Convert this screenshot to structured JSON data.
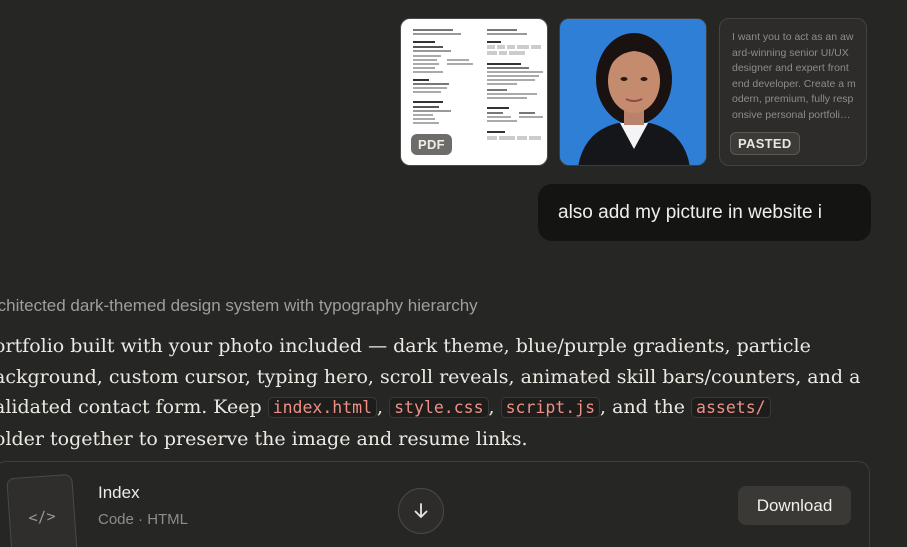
{
  "attachments": {
    "pdf_badge": "PDF",
    "paste_badge": "PASTED",
    "paste_preview": "I want you to act as an award-winning senior UI/UX designer and expert front end developer. Create a modern, premium, fully responsive personal portfoli…"
  },
  "message": {
    "text": "also add my picture in website i"
  },
  "thinking": {
    "summary": "rchitected dark-themed design system with typography hierarchy"
  },
  "response": {
    "line1": "ortfolio built with your photo included — dark theme, blue/purple gradients, particle",
    "line2": "ackground, custom cursor, typing hero, scroll reveals, animated skill bars/counters, and a",
    "line3_pre": "alidated contact form. Keep ",
    "code1": "index.html",
    "sep1": ",",
    "code2": "style.css",
    "sep2": ",",
    "code3": "script.js",
    "line3_mid": ", and the ",
    "code4": "assets/",
    "line4": "older together to preserve the image and resume links."
  },
  "artifact": {
    "icon": "code-brackets-icon",
    "icon_glyph": "</>",
    "title": "Index",
    "subtitle": "Code · HTML",
    "download_label": "Download"
  },
  "colors": {
    "background": "#262624",
    "bubble": "#141413",
    "code_text": "#ef8f86",
    "photo_bg": "#2f7fd6"
  }
}
